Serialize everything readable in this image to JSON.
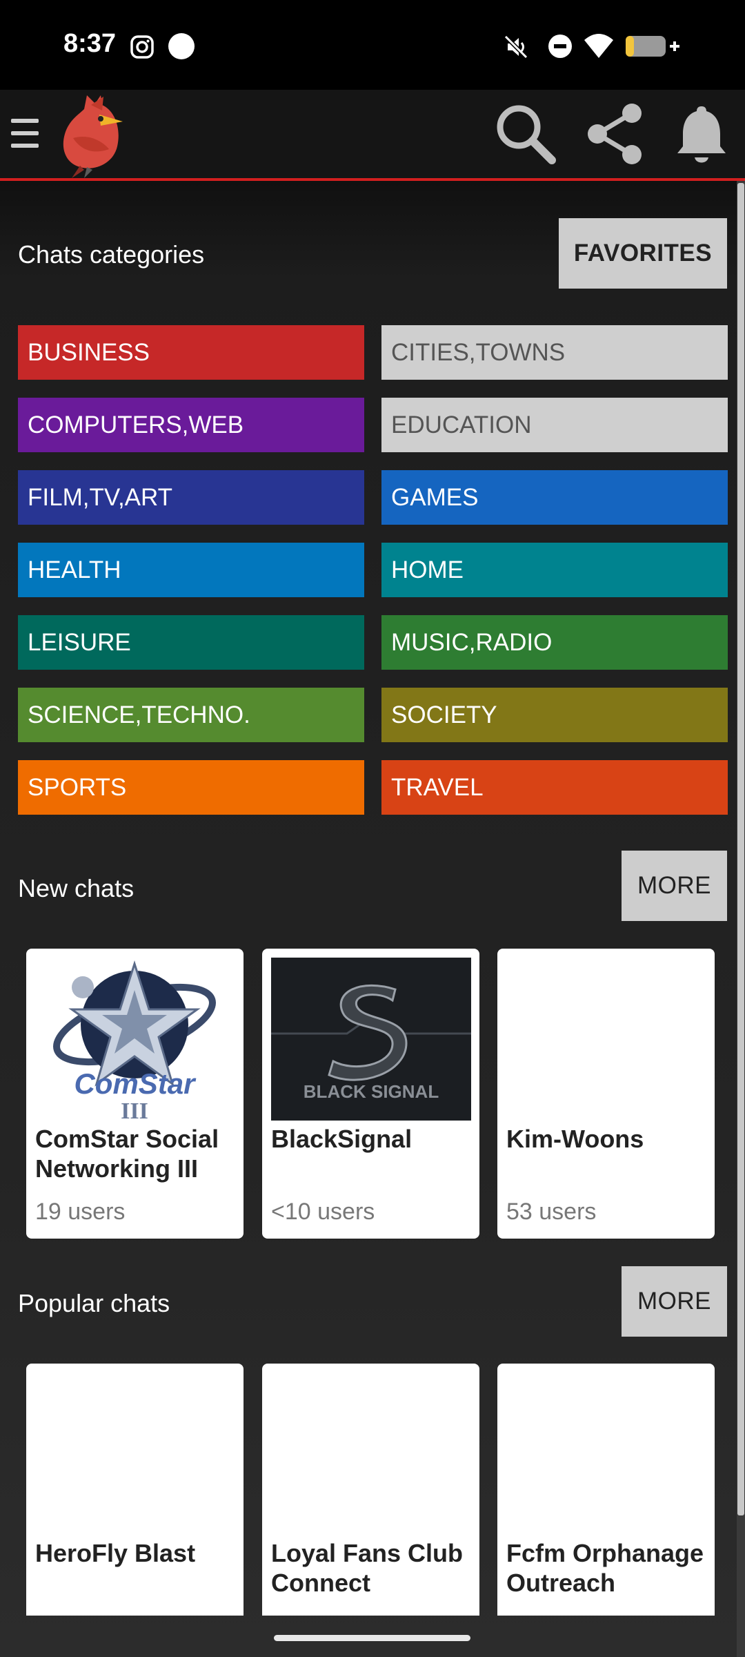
{
  "status_bar": {
    "time": "8:37",
    "icons": [
      "instagram-icon",
      "dot-icon",
      "mute-icon",
      "dnd-icon",
      "wifi-icon",
      "battery-charging-icon"
    ]
  },
  "toolbar": {
    "menu_icon": "hamburger-icon",
    "logo": "cardinal-bird-logo",
    "actions": [
      "search-icon",
      "share-icon",
      "bell-icon"
    ],
    "accent": "#d21f1f"
  },
  "categories_section": {
    "title": "Chats categories",
    "favorites_label": "FAVORITES",
    "items": [
      {
        "label": "BUSINESS",
        "color": "#c62828",
        "text_color": "#ffffff"
      },
      {
        "label": "CITIES,TOWNS",
        "color": "#cfcfcf",
        "text_color": "#555555"
      },
      {
        "label": "COMPUTERS,WEB",
        "color": "#6a1b9a",
        "text_color": "#ffffff"
      },
      {
        "label": "EDUCATION",
        "color": "#cfcfcf",
        "text_color": "#555555"
      },
      {
        "label": "FILM,TV,ART",
        "color": "#283593",
        "text_color": "#ffffff"
      },
      {
        "label": "GAMES",
        "color": "#1565c0",
        "text_color": "#ffffff"
      },
      {
        "label": "HEALTH",
        "color": "#0277bd",
        "text_color": "#ffffff"
      },
      {
        "label": "HOME",
        "color": "#00838f",
        "text_color": "#ffffff"
      },
      {
        "label": "LEISURE",
        "color": "#00695c",
        "text_color": "#ffffff"
      },
      {
        "label": "MUSIC,RADIO",
        "color": "#2e7d32",
        "text_color": "#ffffff"
      },
      {
        "label": "SCIENCE,TECHNO.",
        "color": "#558b2f",
        "text_color": "#ffffff"
      },
      {
        "label": "SOCIETY",
        "color": "#827717",
        "text_color": "#ffffff"
      },
      {
        "label": "SPORTS",
        "color": "#ef6c00",
        "text_color": "#ffffff"
      },
      {
        "label": "TRAVEL",
        "color": "#d84315",
        "text_color": "#ffffff"
      }
    ]
  },
  "new_chats": {
    "title": "New chats",
    "more_label": "MORE",
    "cards": [
      {
        "title": "ComStar Social Networking III",
        "users": "19 users",
        "image": "comstar-logo",
        "image_text": "ComStar",
        "image_numeral": "III"
      },
      {
        "title": "BlackSignal",
        "users": "<10 users",
        "image": "blacksignal-logo",
        "image_text": "BLACK SIGNAL"
      },
      {
        "title": "Kim-Woons",
        "users": "53 users",
        "image": "none"
      }
    ]
  },
  "popular_chats": {
    "title": "Popular chats",
    "more_label": "MORE",
    "cards": [
      {
        "title": "HeroFly Blast"
      },
      {
        "title": "Loyal Fans Club Connect"
      },
      {
        "title": "Fcfm Orphanage Outreach"
      }
    ]
  }
}
